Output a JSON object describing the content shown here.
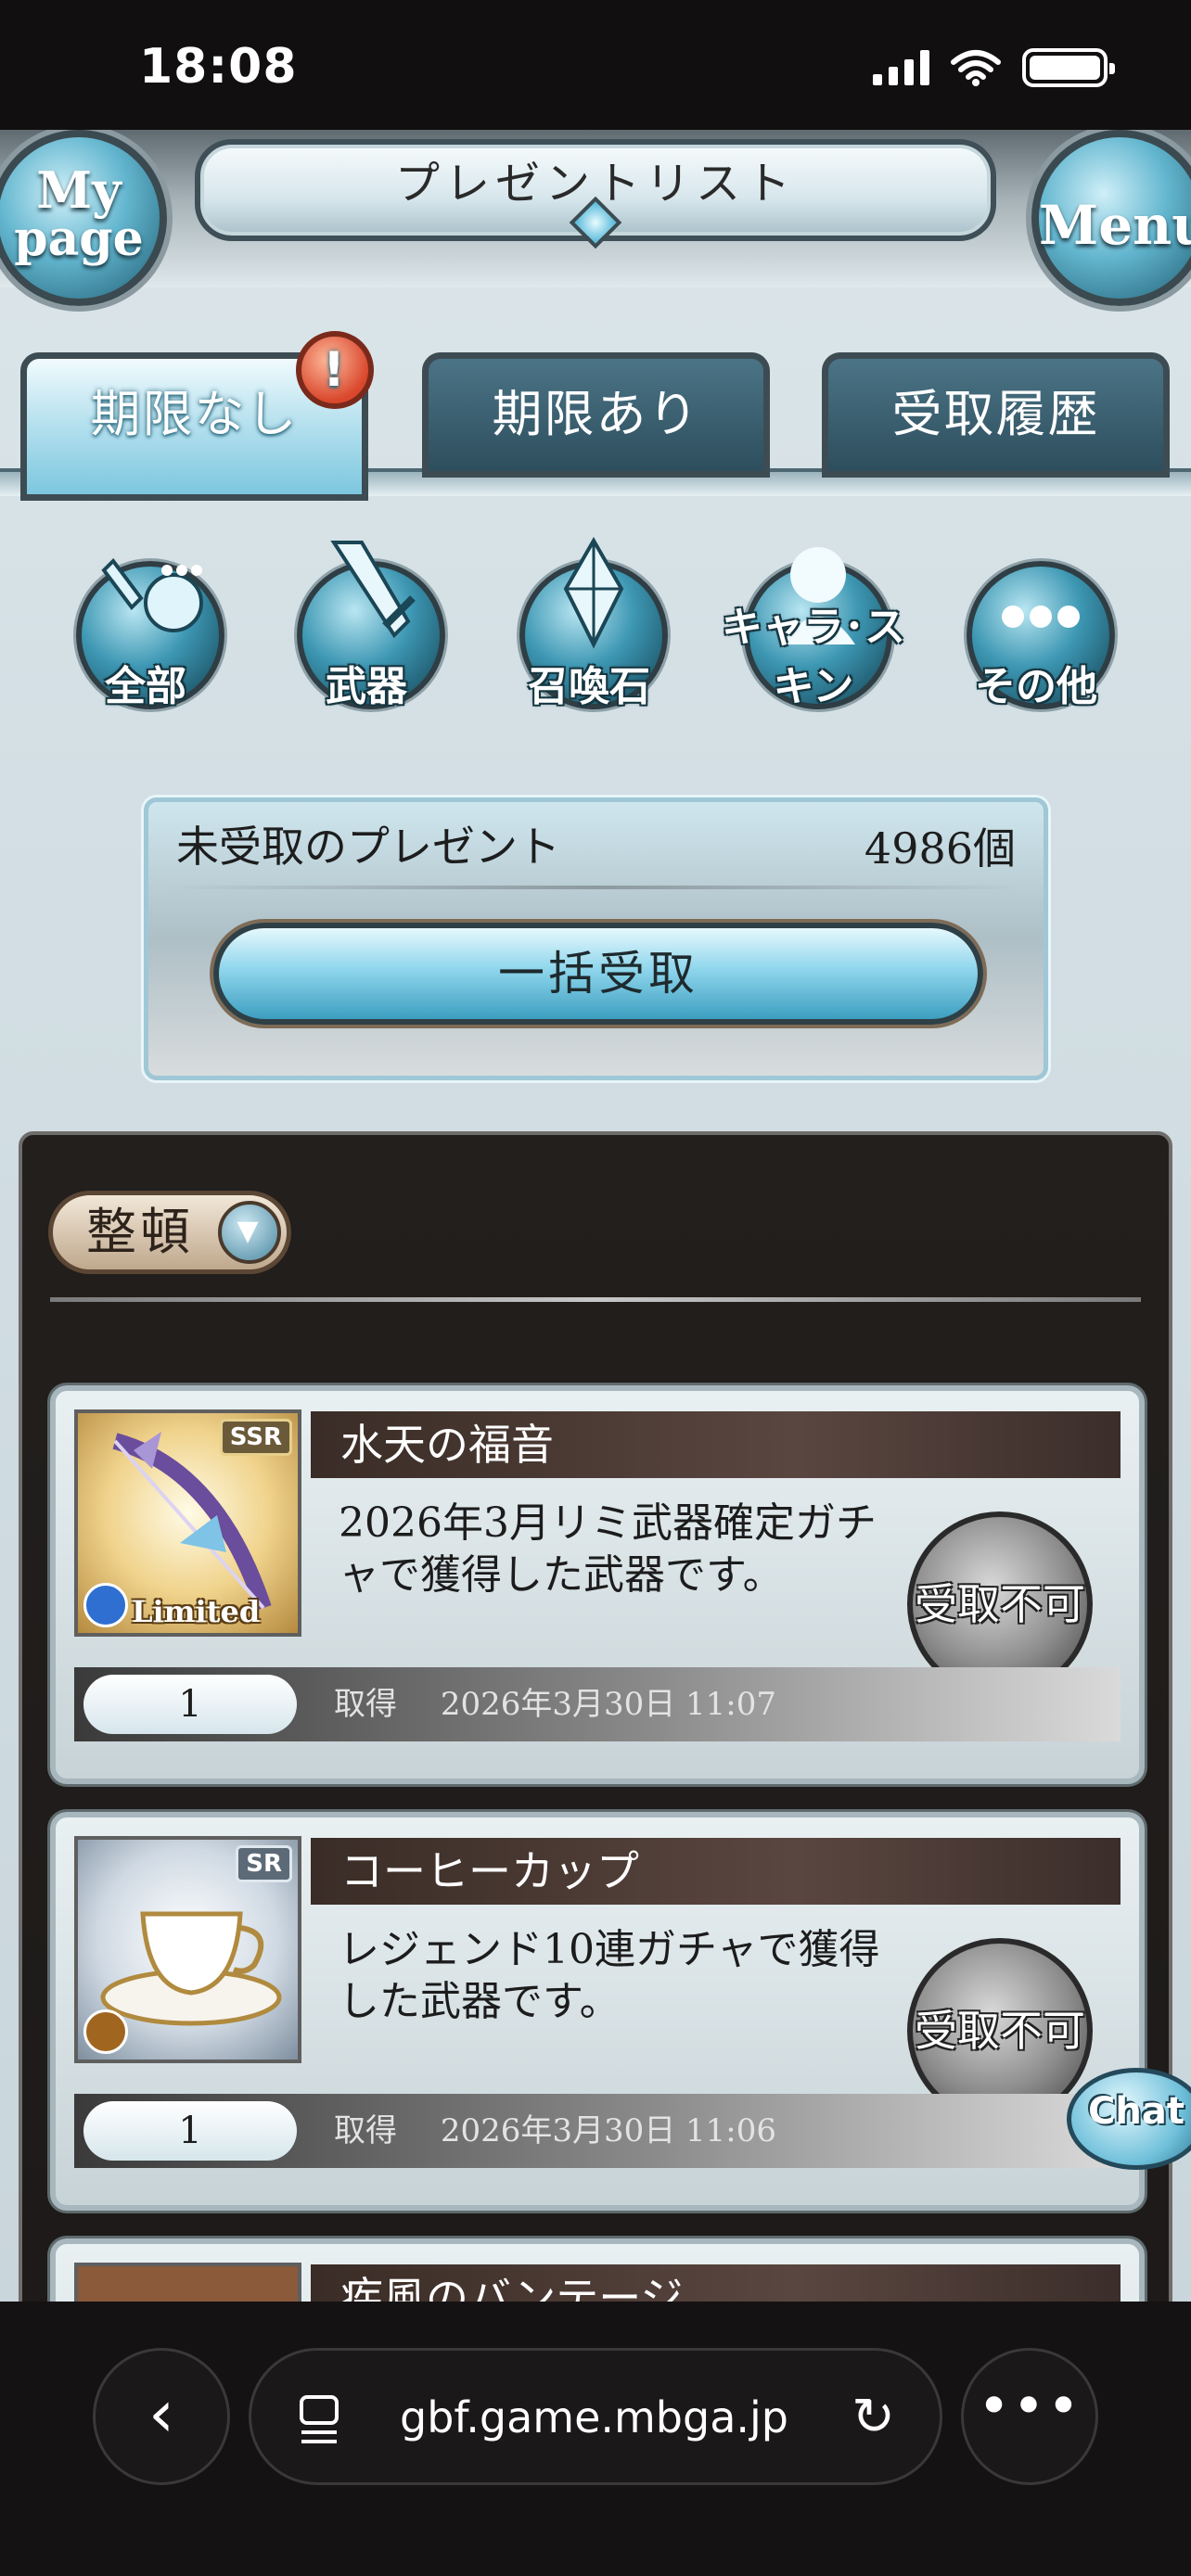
{
  "status_bar": {
    "time": "18:08"
  },
  "header": {
    "title": "プレゼントリスト",
    "mypage_line1": "My",
    "mypage_line2": "page",
    "menu_label": "Menu"
  },
  "tabs": [
    {
      "label": "期限なし",
      "active": true,
      "badge": "!"
    },
    {
      "label": "期限あり",
      "active": false
    },
    {
      "label": "受取履歴",
      "active": false
    }
  ],
  "categories": [
    {
      "label": "全部",
      "icon": "all-icon"
    },
    {
      "label": "武器",
      "icon": "weapon-icon"
    },
    {
      "label": "召喚石",
      "icon": "summon-stone-icon"
    },
    {
      "label": "キャラ･スキン",
      "icon": "character-skin-icon"
    },
    {
      "label": "その他",
      "icon": "more-icon"
    }
  ],
  "unreceived": {
    "label": "未受取のプレゼント",
    "count": "4986個",
    "bulk_button": "一括受取"
  },
  "sort_button": {
    "label": "整頓"
  },
  "items": [
    {
      "name": "水天の福音",
      "rarity": "SSR",
      "tag": "Limited",
      "description": "2026年3月リミ武器確定ガチャで獲得した武器です。",
      "button": "受取不可",
      "quantity": "1",
      "acquired_label": "取得",
      "acquired_date": "2026年3月30日 11:07",
      "element_color": "#2e6fd1"
    },
    {
      "name": "コーヒーカップ",
      "rarity": "SR",
      "description": "レジェンド10連ガチャで獲得した武器です。",
      "button": "受取不可",
      "quantity": "1",
      "acquired_label": "取得",
      "acquired_date": "2026年3月30日 11:06",
      "element_color": "#a0661f"
    },
    {
      "name": "疾風のバンテージ"
    }
  ],
  "chat_button": "Chat",
  "browser": {
    "url": "gbf.game.mbga.jp"
  },
  "colors": {
    "accent": "#63b6cf",
    "panel": "#221f1d",
    "name_bar": "#3a2c26"
  }
}
